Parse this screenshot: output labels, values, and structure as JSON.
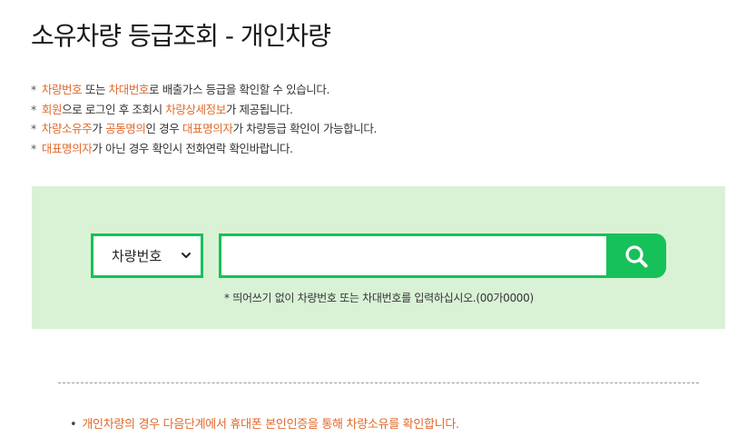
{
  "page": {
    "title": "소유차량 등급조회 - 개인차량"
  },
  "notes": [
    {
      "parts": [
        {
          "text": "차량번호",
          "hl": true
        },
        {
          "text": " 또는 ",
          "hl": false
        },
        {
          "text": "차대번호",
          "hl": true
        },
        {
          "text": "로 배출가스 등급을 확인할 수 있습니다.",
          "hl": false
        }
      ]
    },
    {
      "parts": [
        {
          "text": "회원",
          "hl": true
        },
        {
          "text": "으로 로그인 후 조회시 ",
          "hl": false
        },
        {
          "text": "차량상세정보",
          "hl": true
        },
        {
          "text": "가 제공됩니다.",
          "hl": false
        }
      ]
    },
    {
      "parts": [
        {
          "text": "차량소유주",
          "hl": true
        },
        {
          "text": "가 ",
          "hl": false
        },
        {
          "text": "공동명의",
          "hl": true
        },
        {
          "text": "인 경우 ",
          "hl": false
        },
        {
          "text": "대표명의자",
          "hl": true
        },
        {
          "text": "가 차량등급 확인이 가능합니다.",
          "hl": false
        }
      ]
    },
    {
      "parts": [
        {
          "text": "대표명의자",
          "hl": true
        },
        {
          "text": "가 아닌 경우 확인시 전화연락 확인바랍니다.",
          "hl": false
        }
      ]
    }
  ],
  "note_marker": "*",
  "search": {
    "type_selected": "차량번호",
    "input_value": "",
    "input_placeholder": "",
    "button_icon": "search-icon",
    "hint": "* 띄어쓰기 없이 차량번호 또는 차대번호를 입력하십시오.(00가0000)"
  },
  "footer": {
    "bullet": "•",
    "note": "개인차량의 경우 다음단계에서 휴대폰 본인인증을 통해 차량소유를 확인합니다."
  },
  "colors": {
    "accent_green": "#16c15a",
    "panel_green": "#d9f2d6",
    "highlight_orange": "#e06a2c"
  }
}
